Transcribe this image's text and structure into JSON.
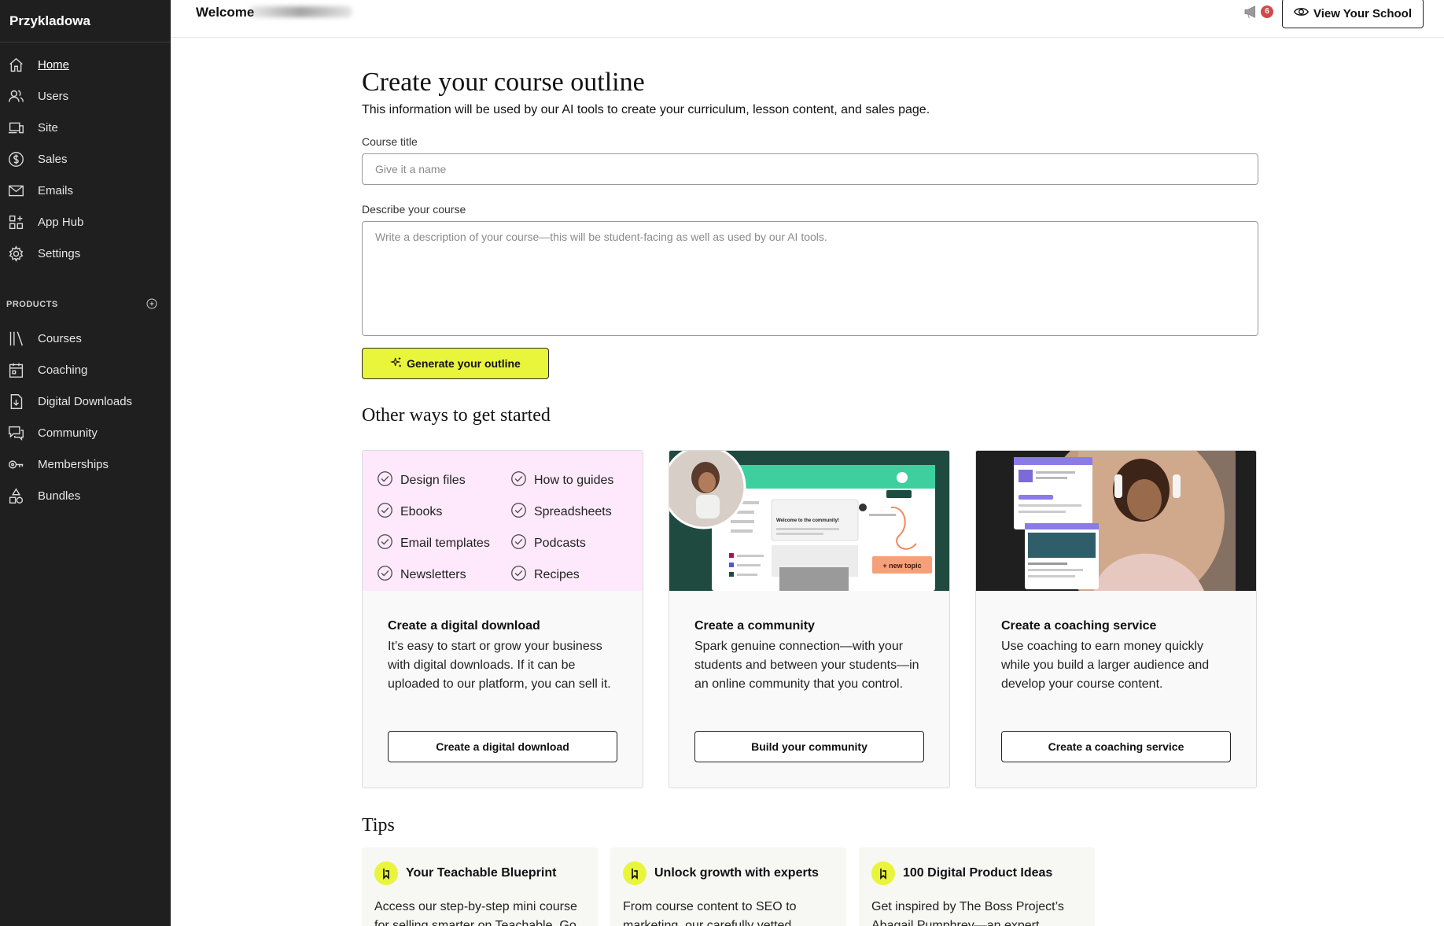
{
  "sidebar": {
    "brand": "Przykladowa",
    "nav": [
      {
        "label": "Home",
        "icon": "home-icon"
      },
      {
        "label": "Users",
        "icon": "users-icon"
      },
      {
        "label": "Site",
        "icon": "site-icon"
      },
      {
        "label": "Sales",
        "icon": "dollar-icon"
      },
      {
        "label": "Emails",
        "icon": "mail-icon"
      },
      {
        "label": "App Hub",
        "icon": "app-grid-icon"
      },
      {
        "label": "Settings",
        "icon": "gear-icon"
      }
    ],
    "products_heading": "PRODUCTS",
    "products": [
      {
        "label": "Courses",
        "icon": "library-icon"
      },
      {
        "label": "Coaching",
        "icon": "calendar-icon"
      },
      {
        "label": "Digital Downloads",
        "icon": "download-file-icon"
      },
      {
        "label": "Community",
        "icon": "chat-icon"
      },
      {
        "label": "Memberships",
        "icon": "key-icon"
      },
      {
        "label": "Bundles",
        "icon": "shapes-icon"
      }
    ]
  },
  "topbar": {
    "welcome": "Welcome",
    "notification_count": "6",
    "view_school": "View Your School"
  },
  "outline": {
    "title": "Create your course outline",
    "subtitle": "This information will be used by our AI tools to create your curriculum, lesson content, and sales page.",
    "course_title_label": "Course title",
    "course_title_placeholder": "Give it a name",
    "course_title_value": "",
    "describe_label": "Describe your course",
    "describe_placeholder": "Write a description of your course—this will be student-facing as well as used by our AI tools.",
    "describe_value": "",
    "generate_button": "Generate your outline"
  },
  "other_ways": {
    "title": "Other ways to get started",
    "download_checklist": [
      "Design files",
      "How to guides",
      "Ebooks",
      "Spreadsheets",
      "Email templates",
      "Podcasts",
      "Newsletters",
      "Recipes"
    ],
    "cards": [
      {
        "title": "Create a digital download",
        "description": "It’s easy to start or grow your business with digital downloads. If it can be uploaded to our platform, you can sell it.",
        "button": "Create a digital download"
      },
      {
        "title": "Create a community",
        "description": "Spark genuine connection—with your students and between your students—in an online community that you control.",
        "button": "Build your community",
        "image_badge": "+ new topic",
        "image_heading": "Welcome to the community!"
      },
      {
        "title": "Create a coaching service",
        "description": "Use coaching to earn money quickly while you build a larger audience and develop your course content.",
        "button": "Create a coaching service"
      }
    ]
  },
  "tips": {
    "title": "Tips",
    "items": [
      {
        "title": "Your Teachable Blueprint",
        "text": "Access our step-by-step mini course for selling smarter on Teachable. Go"
      },
      {
        "title": "Unlock growth with experts",
        "text": "From course content to SEO to marketing, our carefully vetted"
      },
      {
        "title": "100 Digital Product Ideas",
        "text": "Get inspired by The Boss Project’s Abagail Pumphrey—an expert"
      }
    ]
  },
  "colors": {
    "sidebar_bg": "#1f1f1f",
    "accent_yellow": "#e9f53a",
    "pink_panel": "#fde9fb",
    "community_green": "#1f4a3f",
    "badge_red": "#d34848"
  }
}
